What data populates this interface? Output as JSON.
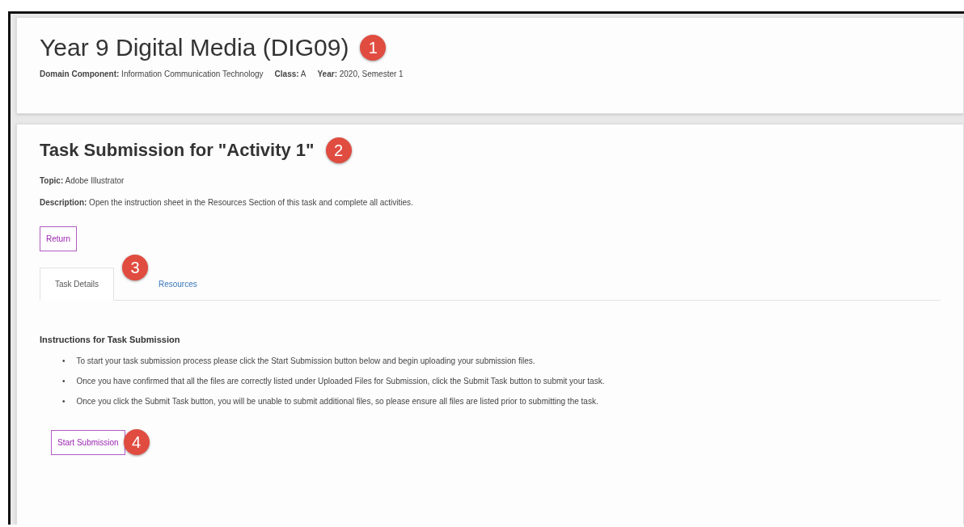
{
  "course": {
    "title": "Year 9 Digital Media (DIG09)",
    "marker": "1",
    "meta": [
      "**Domain Component:** Information Communication Technology",
      "**Class:** A",
      "**Year:** 2020, Semester 1"
    ]
  },
  "task": {
    "title": "Task Submission for \"Activity 1\"",
    "marker": "2",
    "topic": "**Topic:** Adobe Illustrator",
    "description": "**Description:** Open the instruction sheet in the Resources Section of this task and complete all activities.",
    "return_button": "Return",
    "tabs_marker": "3",
    "tabs": [
      {
        "label": "Task Details",
        "selected": true
      },
      {
        "label": "Resources",
        "selected": false
      }
    ],
    "instructions_heading": "Instructions for Task Submission",
    "instructions": [
      {
        "bullet": "•",
        "text": "To start your task submission process please click the Start Submission button below and begin uploading your submission files."
      },
      {
        "bullet": "•",
        "text": "Once you have confirmed that all the files are correctly listed under Uploaded Files for Submission, click the Submit Task button to submit your task."
      },
      {
        "bullet": "•",
        "text": "Once you click the Submit Task button, you will be unable to submit additional files, so please ensure all files are listed prior to submitting the task."
      }
    ],
    "start_button": "Start Submission",
    "start_marker": "4"
  }
}
